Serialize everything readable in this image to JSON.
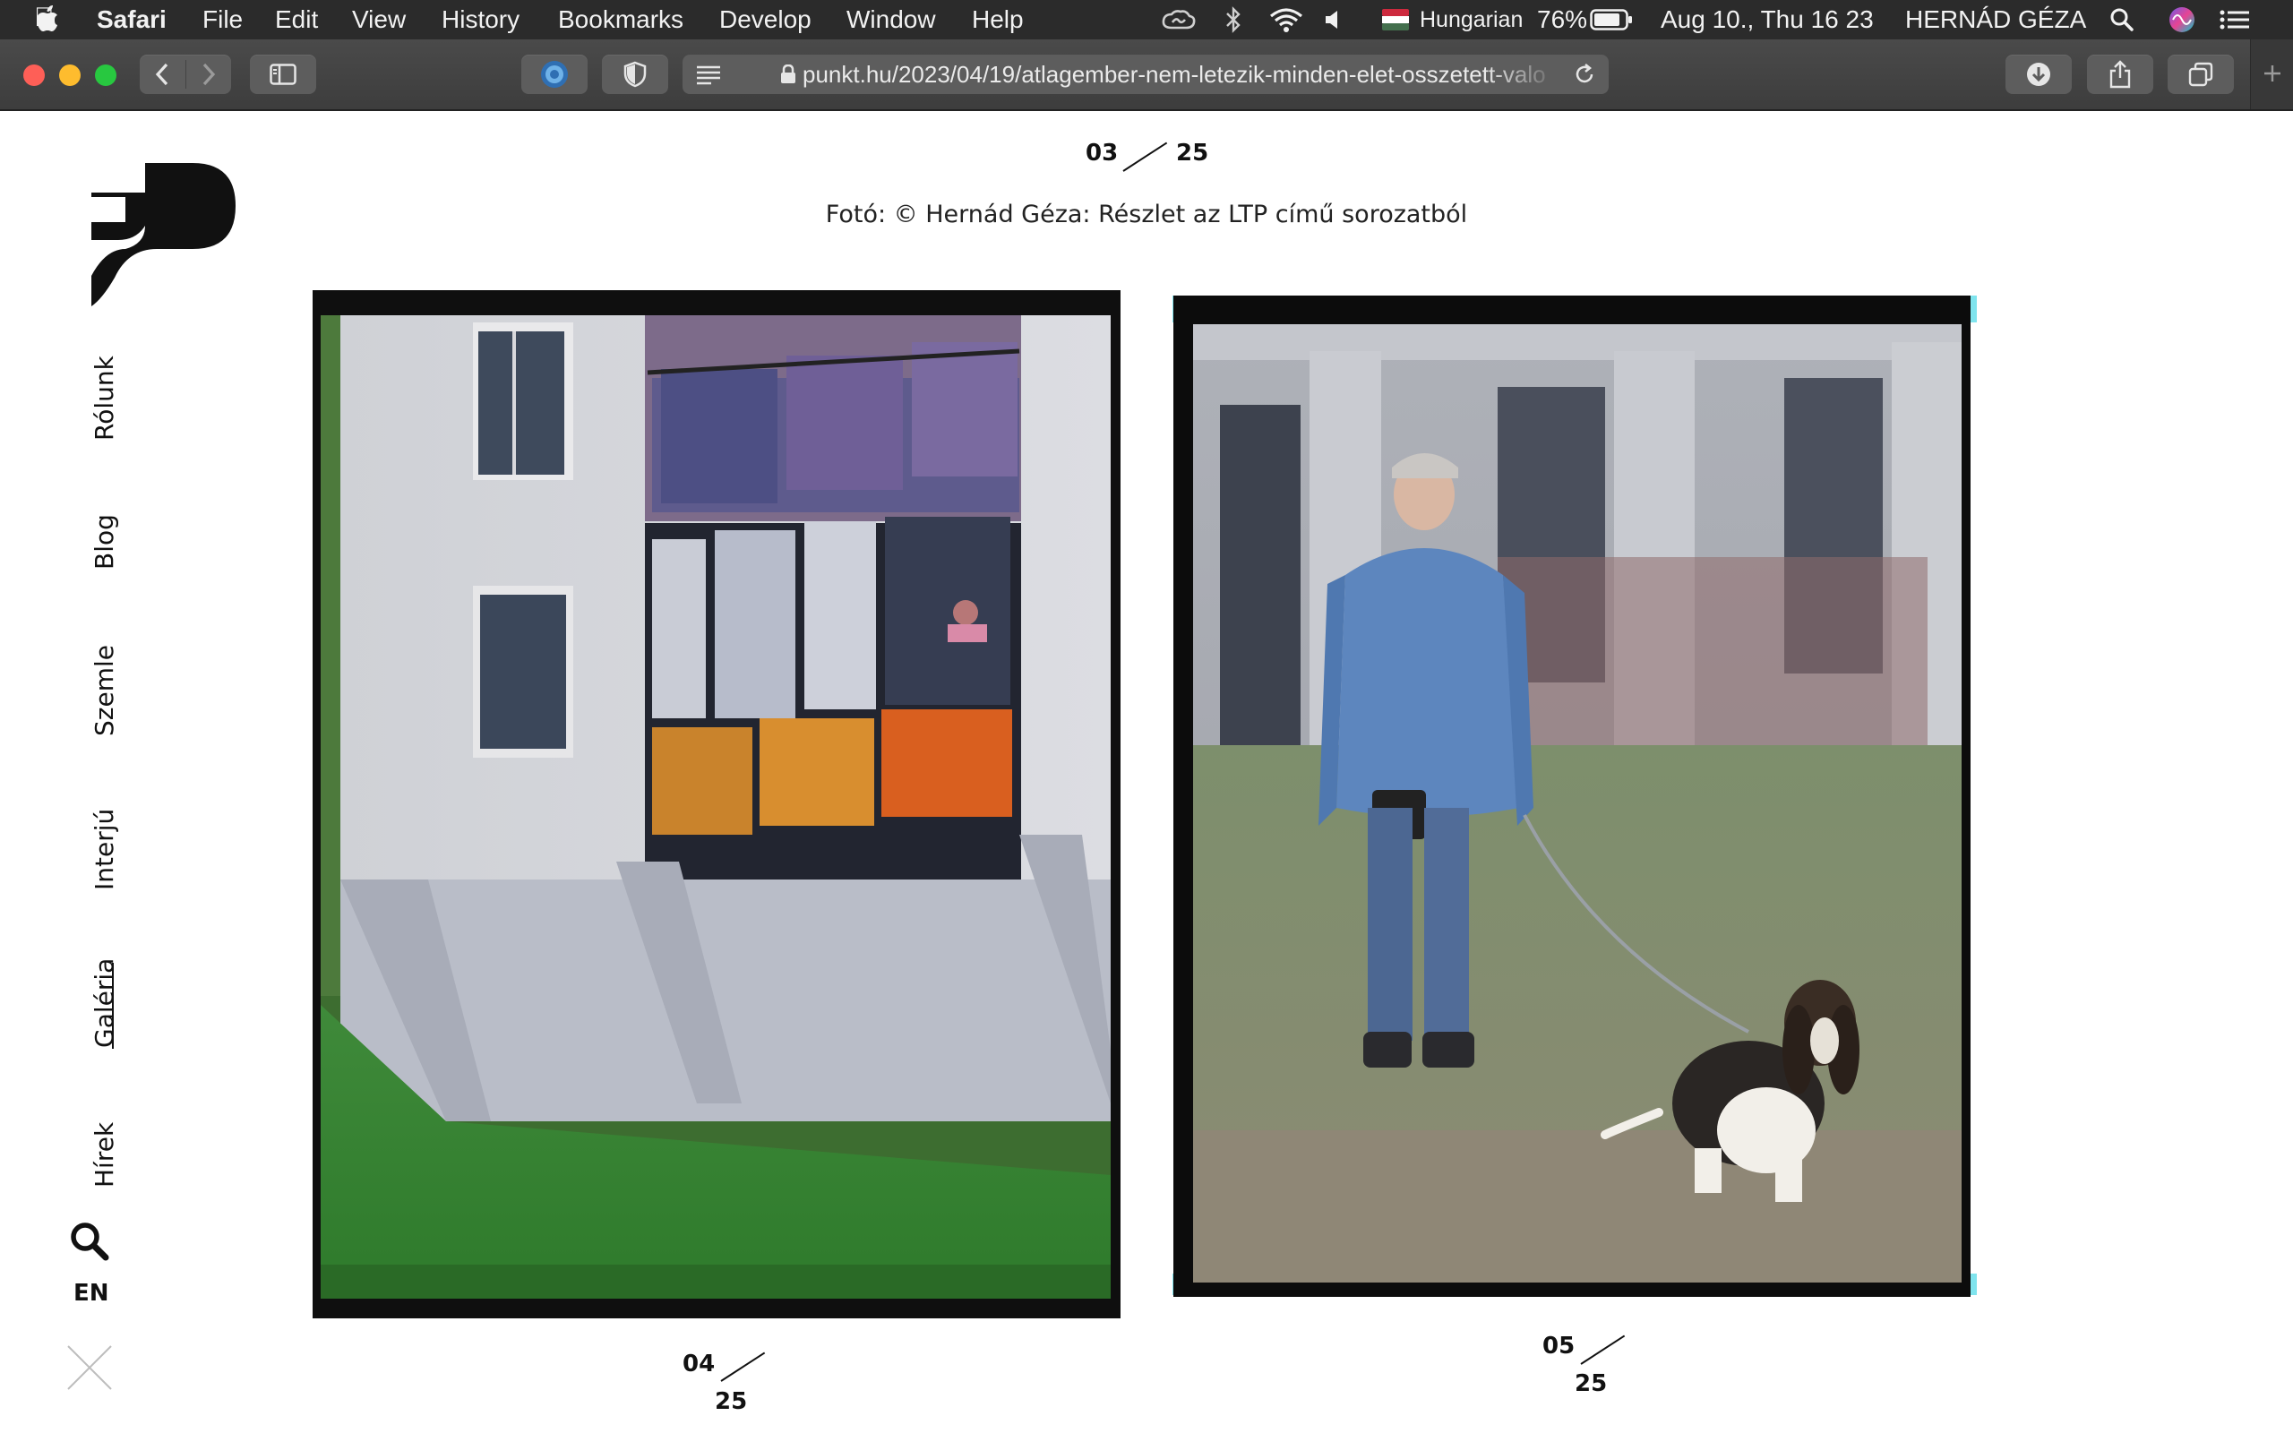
{
  "menubar": {
    "app": "Safari",
    "items": [
      "File",
      "Edit",
      "View",
      "History",
      "Bookmarks",
      "Develop",
      "Window",
      "Help"
    ],
    "input_source": "Hungarian",
    "battery": "76%",
    "datetime": "Aug 10., Thu  16 23",
    "user": "HERNÁD GÉZA"
  },
  "browser": {
    "url": "punkt.hu/2023/04/19/atlagember-nem-letezik-minden-elet-osszetett-valo"
  },
  "page": {
    "top_counter": {
      "current": "03",
      "total": "25"
    },
    "caption": "Fotó: © Hernád Géza: Részlet az LTP című sorozatból",
    "nav": [
      "Rólunk",
      "Blog",
      "Szemle",
      "Interjú",
      "Galéria",
      "Hírek"
    ],
    "active_nav": "Galéria",
    "lang": "EN",
    "photo_left_counter": {
      "current": "04",
      "total": "25"
    },
    "photo_right_counter": {
      "current": "05",
      "total": "25"
    }
  },
  "colors": {
    "menubar_bg": "#2b2b2b",
    "toolbar_bg": "#434343",
    "text": "#111111",
    "film_cyan": "#7fe4ee"
  },
  "icons": [
    "apple-logo",
    "creative-cloud-icon",
    "bluetooth-icon",
    "wifi-icon",
    "volume-icon",
    "hungarian-flag-icon",
    "battery-icon",
    "search-icon",
    "siri-icon",
    "control-center-icon",
    "back-icon",
    "forward-icon",
    "sidebar-icon",
    "extension-icon",
    "shield-icon",
    "reader-icon",
    "lock-icon",
    "reload-icon",
    "downloads-icon",
    "share-icon",
    "tabs-icon",
    "new-tab-icon",
    "punkt-logo",
    "search-icon",
    "close-icon"
  ]
}
